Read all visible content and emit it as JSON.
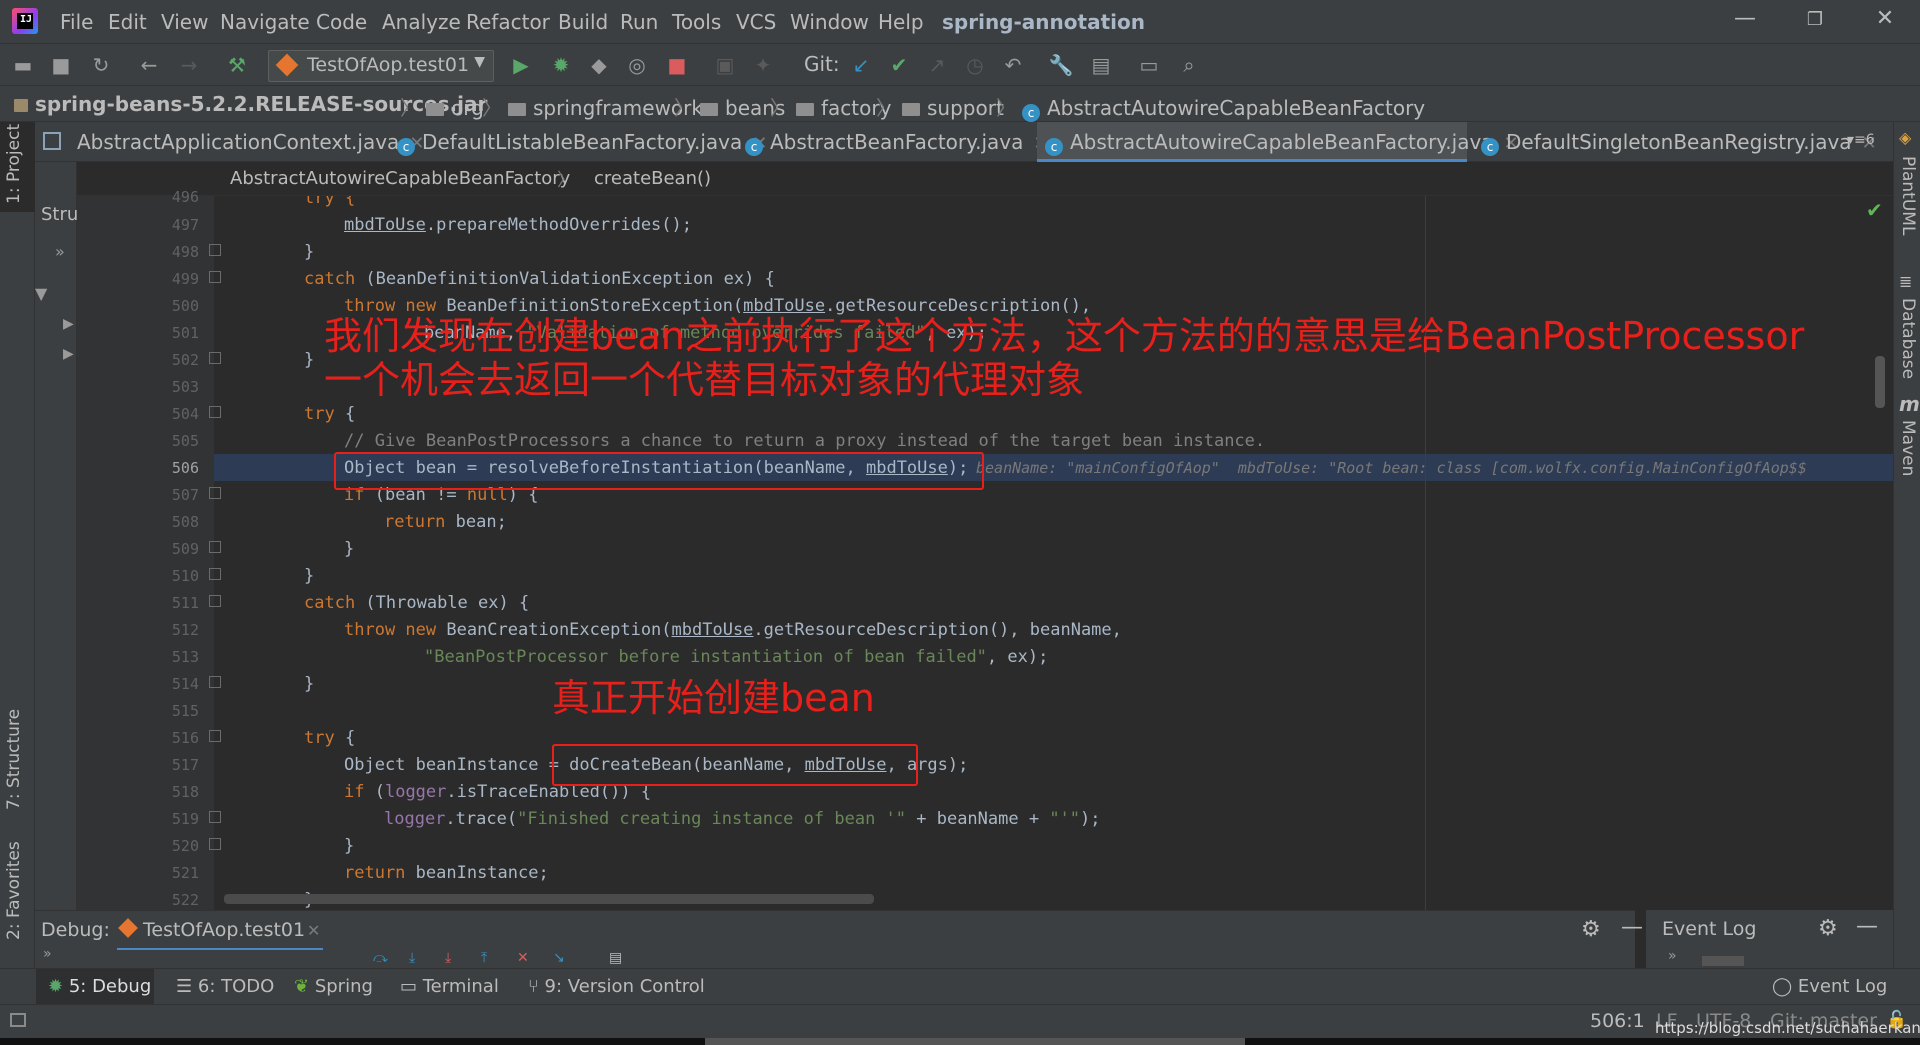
{
  "menubar": {
    "items": [
      "File",
      "Edit",
      "View",
      "Navigate",
      "Code",
      "Analyze",
      "Refactor",
      "Build",
      "Run",
      "Tools",
      "VCS",
      "Window",
      "Help"
    ],
    "project_title": "spring-annotation",
    "minimize": "—",
    "restore": "❐",
    "close": "✕"
  },
  "toolbar": {
    "run_config": "TestOfAop.test01",
    "git_label": "Git:"
  },
  "breadcrumb": {
    "items": [
      "spring-beans-5.2.2.RELEASE-sources.jar",
      "org",
      "springframework",
      "beans",
      "factory",
      "support",
      "AbstractAutowireCapableBeanFactory"
    ]
  },
  "side_tabs": {
    "project": "1: Project",
    "structure": "7: Structure",
    "favorites": "2: Favorites",
    "plantuml": "PlantUML",
    "database": "Database",
    "maven": "Maven"
  },
  "structure_panel": {
    "title": "Stru"
  },
  "editor_tabs": {
    "items": [
      "AbstractApplicationContext.java",
      "DefaultListableBeanFactory.java",
      "AbstractBeanFactory.java",
      "AbstractAutowireCapableBeanFactory.java",
      "DefaultSingletonBeanRegistry.java"
    ],
    "overflow": "6"
  },
  "editor_breadcrumb": {
    "class": "AbstractAutowireCapableBeanFactory",
    "method": "createBean()"
  },
  "gutter": {
    "line_numbers": [
      "496",
      "497",
      "498",
      "499",
      "500",
      "501",
      "502",
      "503",
      "504",
      "505",
      "506",
      "507",
      "508",
      "509",
      "510",
      "511",
      "512",
      "513",
      "514",
      "515",
      "516",
      "517",
      "518",
      "519",
      "520",
      "521",
      "522"
    ]
  },
  "code": {
    "l496": "try {",
    "l497_var": "mbdToUse",
    "l497_rest": ".prepareMethodOverrides();",
    "l498": "}",
    "l499_kw": "catch",
    "l499_rest": " (BeanDefinitionValidationException ex) {",
    "l500_kw": "throw new",
    "l500_a": " BeanDefinitionStoreException(",
    "l500_var": "mbdToUse",
    "l500_b": ".getResourceDescription(),",
    "l501_a": "beanName",
    "l501_b": ", ",
    "l501_str": "\"Validation of method overrides failed\"",
    "l501_c": ", ex);",
    "l502": "}",
    "l504_kw": "try",
    "l504_rest": " {",
    "l505": "// Give BeanPostProcessors a chance to return a proxy instead of the target bean instance.",
    "l506_a": "Object bean = resolveBeforeInstantiation(beanName, ",
    "l506_var": "mbdToUse",
    "l506_b": ");",
    "l506_inline": "beanName: \"mainConfigOfAop\"  mbdToUse: \"Root bean: class [com.wolfx.config.MainConfigOfAop$$",
    "l507_kw": "if",
    "l507_a": " (bean != ",
    "l507_null": "null",
    "l507_b": ") {",
    "l508_kw": "return",
    "l508_rest": " bean;",
    "l509": "}",
    "l510": "}",
    "l511_kw": "catch",
    "l511_rest": " (Throwable ex) {",
    "l512_kw": "throw new",
    "l512_a": " BeanCreationException(",
    "l512_var": "mbdToUse",
    "l512_b": ".getResourceDescription(), beanName,",
    "l513_str": "\"BeanPostProcessor before instantiation of bean failed\"",
    "l513_rest": ", ex);",
    "l514": "}",
    "l516_kw": "try",
    "l516_rest": " {",
    "l517_a": "Object beanInstance = doCreateBean(beanName, ",
    "l517_var": "mbdToUse",
    "l517_b": ", args);",
    "l518_kw": "if",
    "l518_a": " (",
    "l518_fld": "logger",
    "l518_b": ".isTraceEnabled()) {",
    "l519_fld": "logger",
    "l519_a": ".trace(",
    "l519_str": "\"Finished creating instance of bean '\"",
    "l519_b": " + beanName + ",
    "l519_str2": "\"'\"",
    "l519_c": ");",
    "l520": "}",
    "l521_kw": "return",
    "l521_rest": " beanInstance;",
    "l522": "}"
  },
  "annotations": {
    "note1_line1": "我们发现在创建bean之前执行了这个方法，这个方法的的意思是给BeanPostProcessor",
    "note1_line2": "一个机会去返回一个代替目标对象的代理对象",
    "note2": "真正开始创建bean"
  },
  "debug_bar": {
    "label": "Debug:",
    "session": "TestOfAop.test01",
    "event_log_title": "Event Log"
  },
  "tool_tabs": {
    "debug": "5: Debug",
    "todo": "6: TODO",
    "spring": "Spring",
    "terminal": "Terminal",
    "version_control": "9: Version Control",
    "event_log": "Event Log"
  },
  "status_bar": {
    "position": "506:1",
    "line_sep": "LF",
    "encoding": "UTF-8",
    "git": "Git: master",
    "watermark": "https://blog.csdn.net/suchahaerkang"
  },
  "colors": {
    "annotation_red": "#e8201b",
    "keyword": "#cc7832",
    "string": "#6a8759",
    "comment": "#808080",
    "field": "#9876aa",
    "exec_line": "#2d3b55"
  }
}
